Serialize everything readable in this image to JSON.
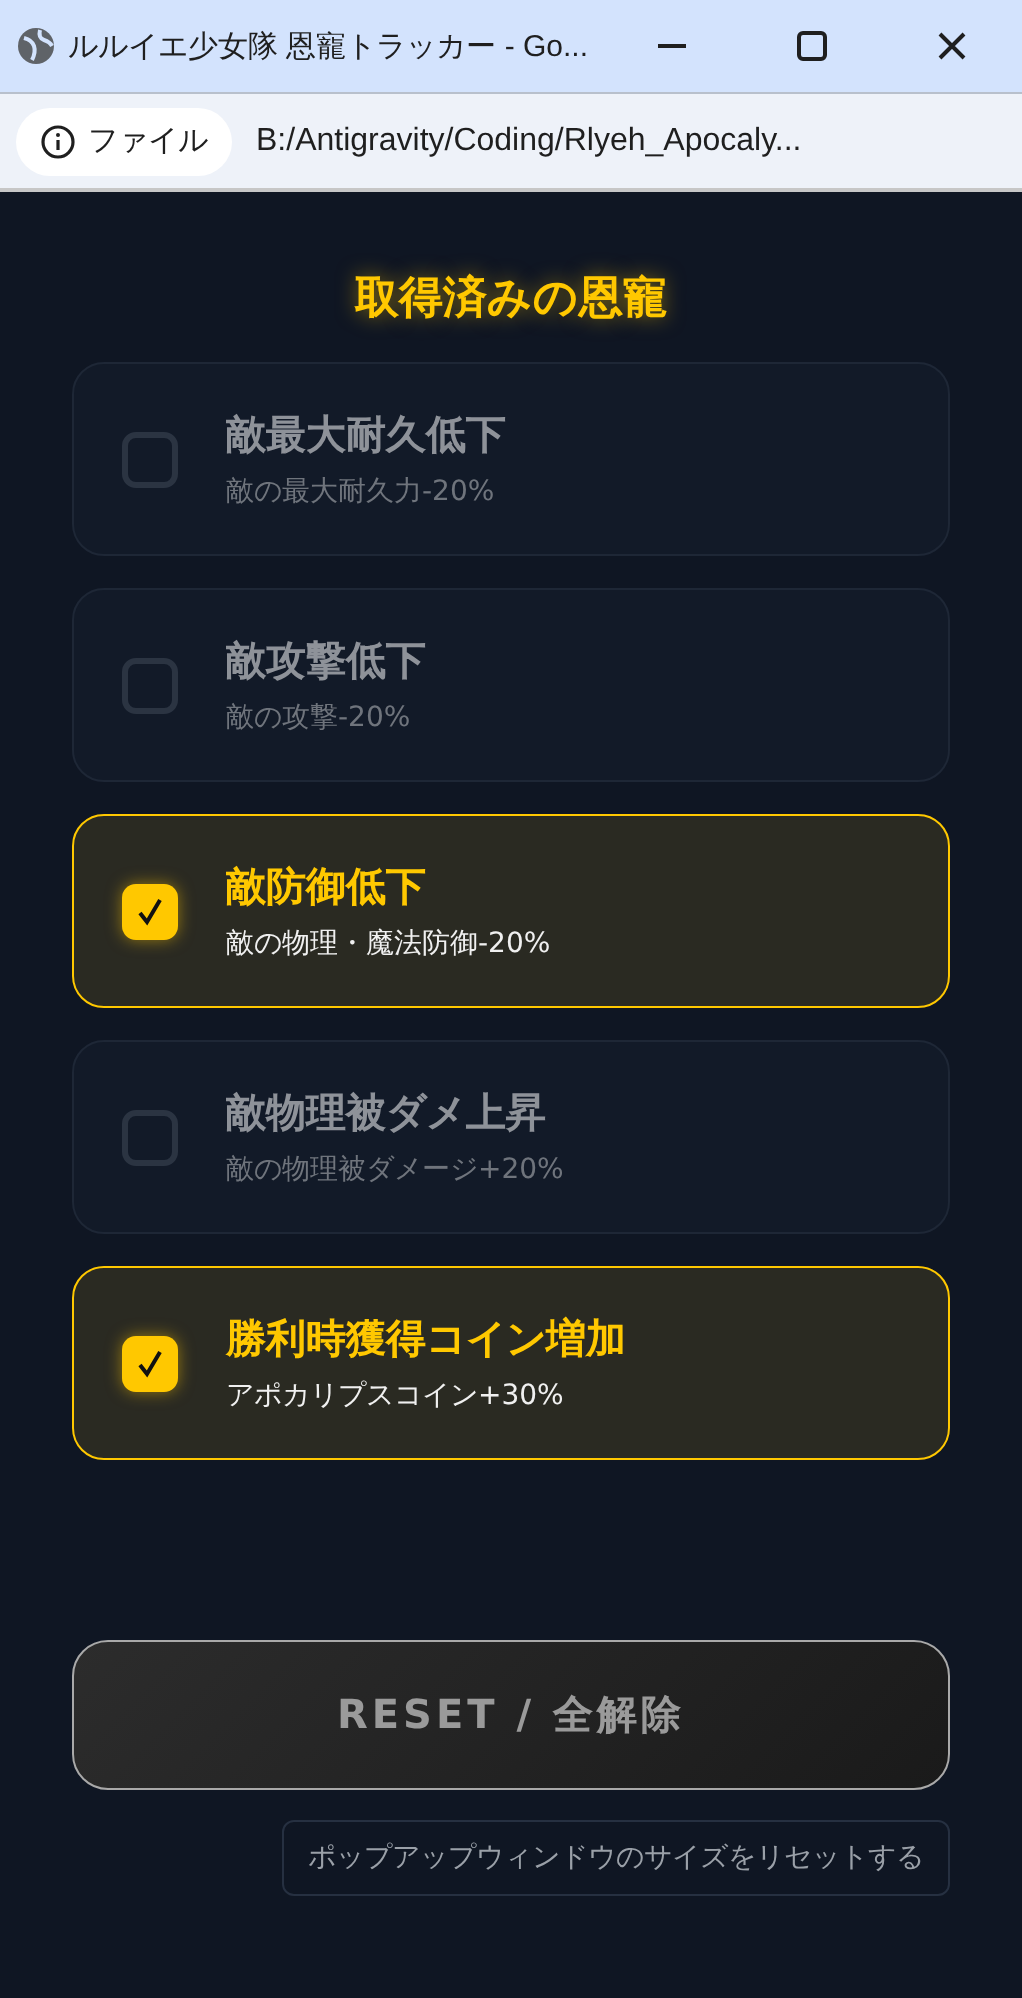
{
  "window": {
    "title": "ルルイエ少女隊 恩寵トラッカー - Go..."
  },
  "address_bar": {
    "badge": "ファイル",
    "url": "B:/Antigravity/Coding/Rlyeh_Apocaly..."
  },
  "heading": "取得済みの恩寵",
  "blessings": [
    {
      "name": "敵最大耐久低下",
      "effect": "敵の最大耐久力-20%",
      "checked": false
    },
    {
      "name": "敵攻撃低下",
      "effect": "敵の攻撃-20%",
      "checked": false
    },
    {
      "name": "敵防御低下",
      "effect": "敵の物理・魔法防御-20%",
      "checked": true
    },
    {
      "name": "敵物理被ダメ上昇",
      "effect": "敵の物理被ダメージ+20%",
      "checked": false
    },
    {
      "name": "勝利時獲得コイン増加",
      "effect": "アポカリプスコイン+30%",
      "checked": true
    }
  ],
  "reset_button": "RESET / 全解除",
  "resize_button": "ポップアップウィンドウのサイズをリセットする"
}
